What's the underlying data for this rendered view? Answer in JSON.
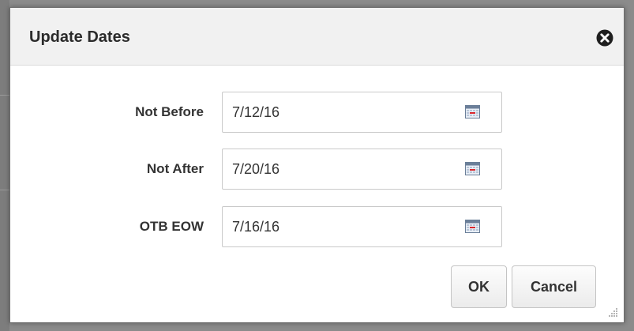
{
  "dialog": {
    "title": "Update Dates",
    "close_icon": "close-circle-icon"
  },
  "fields": [
    {
      "label": "Not Before",
      "value": "7/12/16",
      "icon": "calendar-icon"
    },
    {
      "label": "Not After",
      "value": "7/20/16",
      "icon": "calendar-icon"
    },
    {
      "label": "OTB EOW",
      "value": "7/16/16",
      "icon": "calendar-icon"
    }
  ],
  "buttons": {
    "ok_label": "OK",
    "cancel_label": "Cancel"
  },
  "colors": {
    "header_bg": "#f1f1f1",
    "dialog_bg": "#ffffff",
    "overlay": "#8b8b8b",
    "text": "#333333",
    "calendar_accent": "#d9262c"
  }
}
